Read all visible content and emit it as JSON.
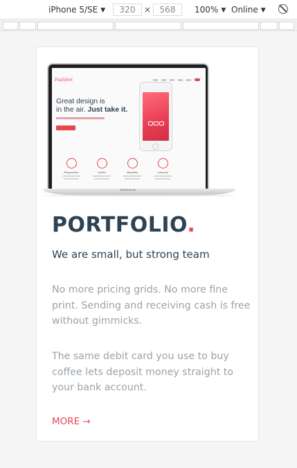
{
  "devtools": {
    "device": "iPhone 5/SE",
    "width": "320",
    "height": "568",
    "times": "×",
    "zoom": "100%",
    "network": "Online",
    "dropdown_arrow": "▼",
    "rotate_icon": "rotate-icon"
  },
  "card": {
    "title": "PORTFOLIO",
    "title_dot": ".",
    "subtitle": "We are small, but strong team",
    "paragraph1": "No more pricing grids. No more fine print. Sending and receiving cash is free without gimmicks.",
    "paragraph2": "The same debit card you use to buy coffee lets deposit money straight to your bank account.",
    "more_label": "MORE →",
    "accent_color": "#e64857",
    "heading_color": "#2d4353"
  },
  "mockup": {
    "logo": "Fashfeet",
    "headline_line1": "Great design is",
    "headline_line2_a": "in the air.",
    "headline_line2_b": "Just take it.",
    "features": [
      "Responsive",
      "Useful",
      "Beautiful",
      "Colourful"
    ],
    "laptop_label": "MacBook Air"
  }
}
